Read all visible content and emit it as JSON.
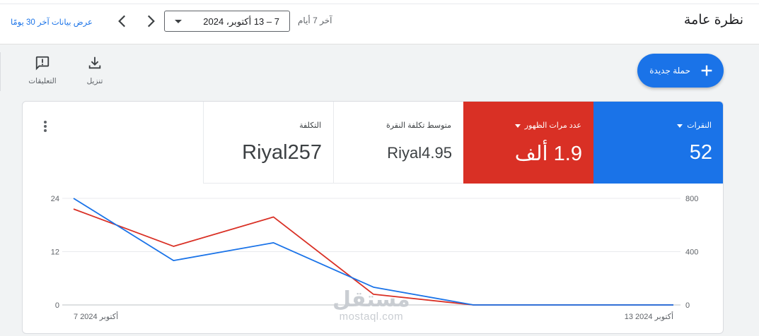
{
  "header": {
    "title": "نظرة عامة",
    "date_label": "آخر 7 أيام",
    "date_range": "7 – 13 أكتوبر، 2024",
    "view_30_link": "عرض بيانات آخر 30 يومًا"
  },
  "toolbar": {
    "download_label": "تنزيل",
    "feedback_label": "التعليقات",
    "new_campaign_label": "حملة جديدة"
  },
  "metrics": {
    "clicks": {
      "label": "النقرات",
      "value": "52",
      "color": "#1a73e8"
    },
    "impressions": {
      "label": "عدد مرات الظهور",
      "value": "1.9 ألف",
      "color": "#d93025"
    },
    "avg_cpc": {
      "label": "متوسط تكلفة النقرة",
      "value": "Riyal4.95"
    },
    "cost": {
      "label": "التكلفة",
      "value": "Riyal257"
    }
  },
  "chart_data": {
    "type": "line",
    "x": [
      "7 أكتوبر 2024",
      "8",
      "9",
      "10",
      "11",
      "12",
      "13 أكتوبر 2024"
    ],
    "x_tick_labels": [
      "7 أكتوبر 2024",
      "13 أكتوبر 2024"
    ],
    "left_axis": {
      "ticks": [
        0,
        12,
        24
      ],
      "ylim": [
        0,
        24
      ]
    },
    "right_axis": {
      "ticks": [
        0,
        400,
        800
      ],
      "ylim": [
        0,
        800
      ]
    },
    "series": [
      {
        "axis": "left",
        "color": "#1a73e8",
        "values": [
          24,
          10,
          14,
          4,
          0,
          0,
          0
        ]
      },
      {
        "axis": "right",
        "color": "#d93025",
        "values": [
          720,
          440,
          660,
          80,
          0,
          0,
          0
        ]
      }
    ],
    "grid": true
  },
  "watermark": {
    "arabic": "مستقل",
    "latin": "mostaql.com"
  }
}
